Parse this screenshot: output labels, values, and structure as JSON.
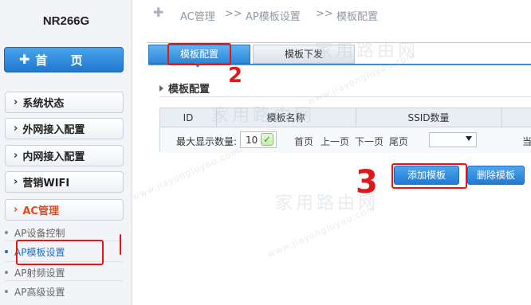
{
  "sidebar": {
    "brand": "NR266G",
    "home_label": "首 页",
    "menu": [
      {
        "label": "系统状态",
        "active": false
      },
      {
        "label": "外网接入配置",
        "active": false
      },
      {
        "label": "内网接入配置",
        "active": false
      },
      {
        "label": "营销WIFI",
        "active": false
      },
      {
        "label": "AC管理",
        "active": true
      }
    ],
    "sub_items": [
      {
        "label": "AP设备控制",
        "active": false
      },
      {
        "label": "AP模板设置",
        "active": true
      },
      {
        "label": "AP射频设置",
        "active": false
      },
      {
        "label": "AP高级设置",
        "active": false
      }
    ]
  },
  "breadcrumb": [
    "AC管理",
    ">>",
    "AP模板设置",
    ">>",
    "模板配置"
  ],
  "tabs": [
    {
      "label": "模板配置",
      "active": true
    },
    {
      "label": "模板下发",
      "active": false
    }
  ],
  "section_title": "模板配置",
  "table": {
    "headers": [
      "ID",
      "模板名称",
      "SSID数量"
    ],
    "footer": {
      "max_display_label": "最大显示数量:",
      "max_display_value": "10",
      "pager": [
        "首页",
        "上一页",
        "下一页",
        "尾页"
      ],
      "current_label": "当前:0"
    }
  },
  "buttons": {
    "add": "添加模板",
    "delete": "删除模板"
  },
  "annotations": {
    "num_2": "2",
    "num_3": "3"
  },
  "watermark": {
    "main": "家用路由网",
    "url": "www.jiayongluyou.com"
  },
  "colors": {
    "accent": "#2e86d6",
    "annotation": "#e01818",
    "active_menu": "#e34a1d"
  }
}
